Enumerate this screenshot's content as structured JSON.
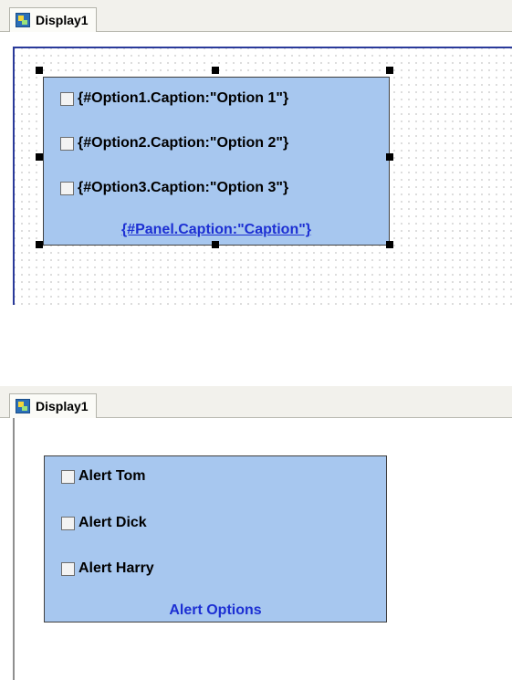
{
  "design_view": {
    "tab_label": "Display1",
    "options": [
      {
        "label": "{#Option1.Caption:\"Option 1\"}"
      },
      {
        "label": "{#Option2.Caption:\"Option 2\"}"
      },
      {
        "label": "{#Option3.Caption:\"Option 3\"}"
      }
    ],
    "panel_caption": "{#Panel.Caption:\"Caption\"}"
  },
  "runtime_view": {
    "tab_label": "Display1",
    "options": [
      {
        "label": "Alert Tom"
      },
      {
        "label": "Alert Dick"
      },
      {
        "label": "Alert Harry"
      }
    ],
    "panel_caption": "Alert Options"
  },
  "colors": {
    "panel_fill": "#a7c7ef",
    "caption_text": "#1c2fd3",
    "canvas_border": "#2a3a9a"
  }
}
